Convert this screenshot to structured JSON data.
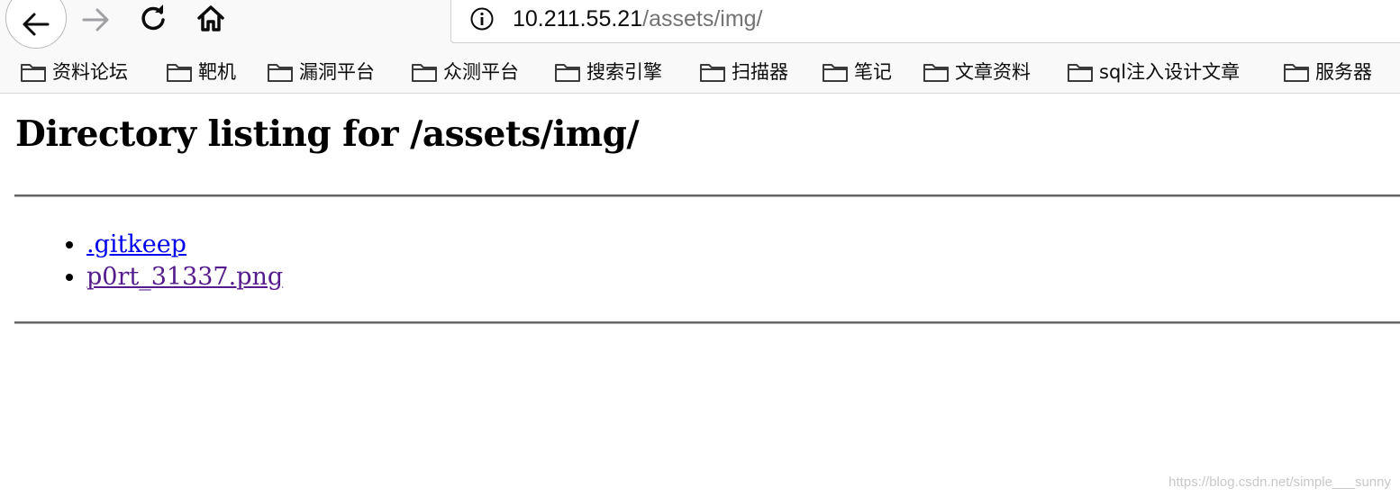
{
  "browser": {
    "url_host": "10.211.55.21",
    "url_path": "/assets/img/"
  },
  "bookmarks": [
    {
      "label": "资料论坛"
    },
    {
      "label": "靶机"
    },
    {
      "label": "漏洞平台"
    },
    {
      "label": "众测平台"
    },
    {
      "label": "搜索引擎"
    },
    {
      "label": "扫描器"
    },
    {
      "label": "笔记"
    },
    {
      "label": "文章资料"
    },
    {
      "label": "sql注入设计文章"
    },
    {
      "label": "服务器"
    }
  ],
  "page": {
    "title": "Directory listing for /assets/img/",
    "files": [
      {
        "name": ".gitkeep",
        "visited": false
      },
      {
        "name": "p0rt_31337.png",
        "visited": true
      }
    ]
  },
  "watermark": "https://blog.csdn.net/simple___sunny",
  "colors": {
    "link": "#0000ee",
    "visited_link": "#551a8b",
    "toolbar_bg": "#f9f9fa"
  }
}
